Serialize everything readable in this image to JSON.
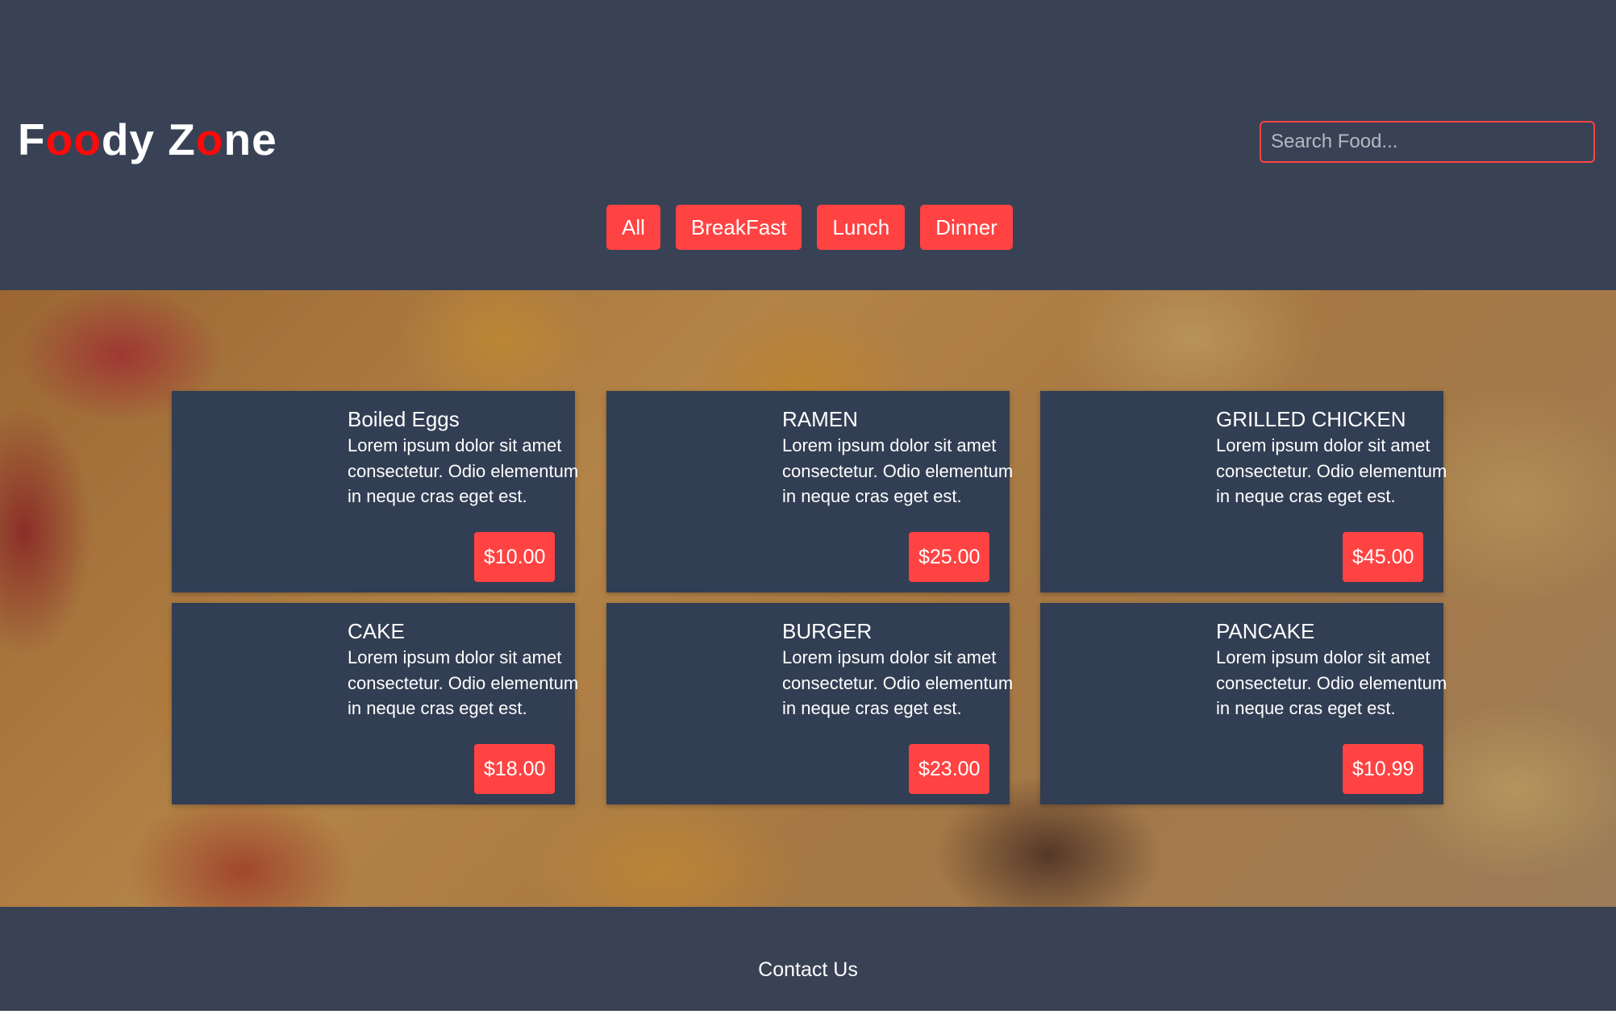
{
  "logo": {
    "part1": "F",
    "part2": "oo",
    "part3": "dy Z",
    "part4": "o",
    "part5": "ne"
  },
  "search": {
    "placeholder": "Search Food..."
  },
  "filters": [
    "All",
    "BreakFast",
    "Lunch",
    "Dinner"
  ],
  "foods": [
    {
      "name": "Boiled Eggs",
      "description": "Lorem ipsum dolor sit amet consectetur. Odio elementum in neque cras eget est.",
      "price": "$10.00"
    },
    {
      "name": "RAMEN",
      "description": "Lorem ipsum dolor sit amet consectetur. Odio elementum in neque cras eget est.",
      "price": "$25.00"
    },
    {
      "name": "GRILLED CHICKEN",
      "description": "Lorem ipsum dolor sit amet consectetur. Odio elementum in neque cras eget est.",
      "price": "$45.00"
    },
    {
      "name": "CAKE",
      "description": "Lorem ipsum dolor sit amet consectetur. Odio elementum in neque cras eget est.",
      "price": "$18.00"
    },
    {
      "name": "BURGER",
      "description": "Lorem ipsum dolor sit amet consectetur. Odio elementum in neque cras eget est.",
      "price": "$23.00"
    },
    {
      "name": "PANCAKE",
      "description": "Lorem ipsum dolor sit amet consectetur. Odio elementum in neque cras eget est.",
      "price": "$10.99"
    }
  ],
  "footer": {
    "contact": "Contact Us"
  },
  "colors": {
    "background": "#394255",
    "card": "#323e53",
    "accent": "#ff4343",
    "logo_accent": "#ff0909"
  }
}
